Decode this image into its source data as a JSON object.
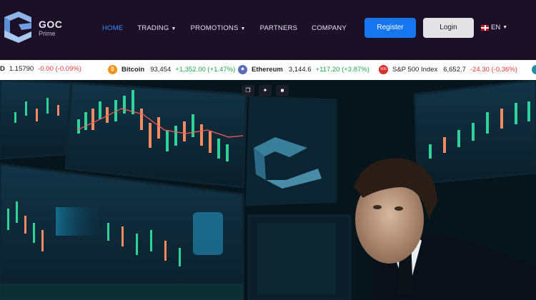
{
  "brand": {
    "name": "GOC",
    "sub": "Prime"
  },
  "nav": {
    "home": "HOME",
    "trading": "TRADING",
    "promotions": "PROMOTIONS",
    "partners": "PARTNERS",
    "company": "COMPANY"
  },
  "actions": {
    "register": "Register",
    "login": "Login",
    "language": "EN"
  },
  "ticker": [
    {
      "name": "D",
      "price": "1.15790",
      "change": "-0.00 (-0.09%)",
      "direction": "down",
      "icon": "partial-icon"
    },
    {
      "name": "Bitcoin",
      "price": "93,454",
      "change": "+1,352.00 (+1.47%)",
      "direction": "up",
      "icon": "bitcoin-icon"
    },
    {
      "name": "Ethereum",
      "price": "3,144.6",
      "change": "+117.20 (+3.87%)",
      "direction": "up",
      "icon": "ethereum-icon"
    },
    {
      "name": "S&P 500 Index",
      "price": "6,652.7",
      "change": "-24.30 (-0.36%)",
      "direction": "down",
      "icon": "sp500-icon"
    }
  ],
  "ticker_icon_labels": {
    "bitcoin": "₿",
    "ethereum": "◆",
    "sp500": "500"
  },
  "colors": {
    "accent": "#1576f0",
    "up": "#1fa64a",
    "down": "#e53935",
    "header_bg": "#1b1028"
  }
}
